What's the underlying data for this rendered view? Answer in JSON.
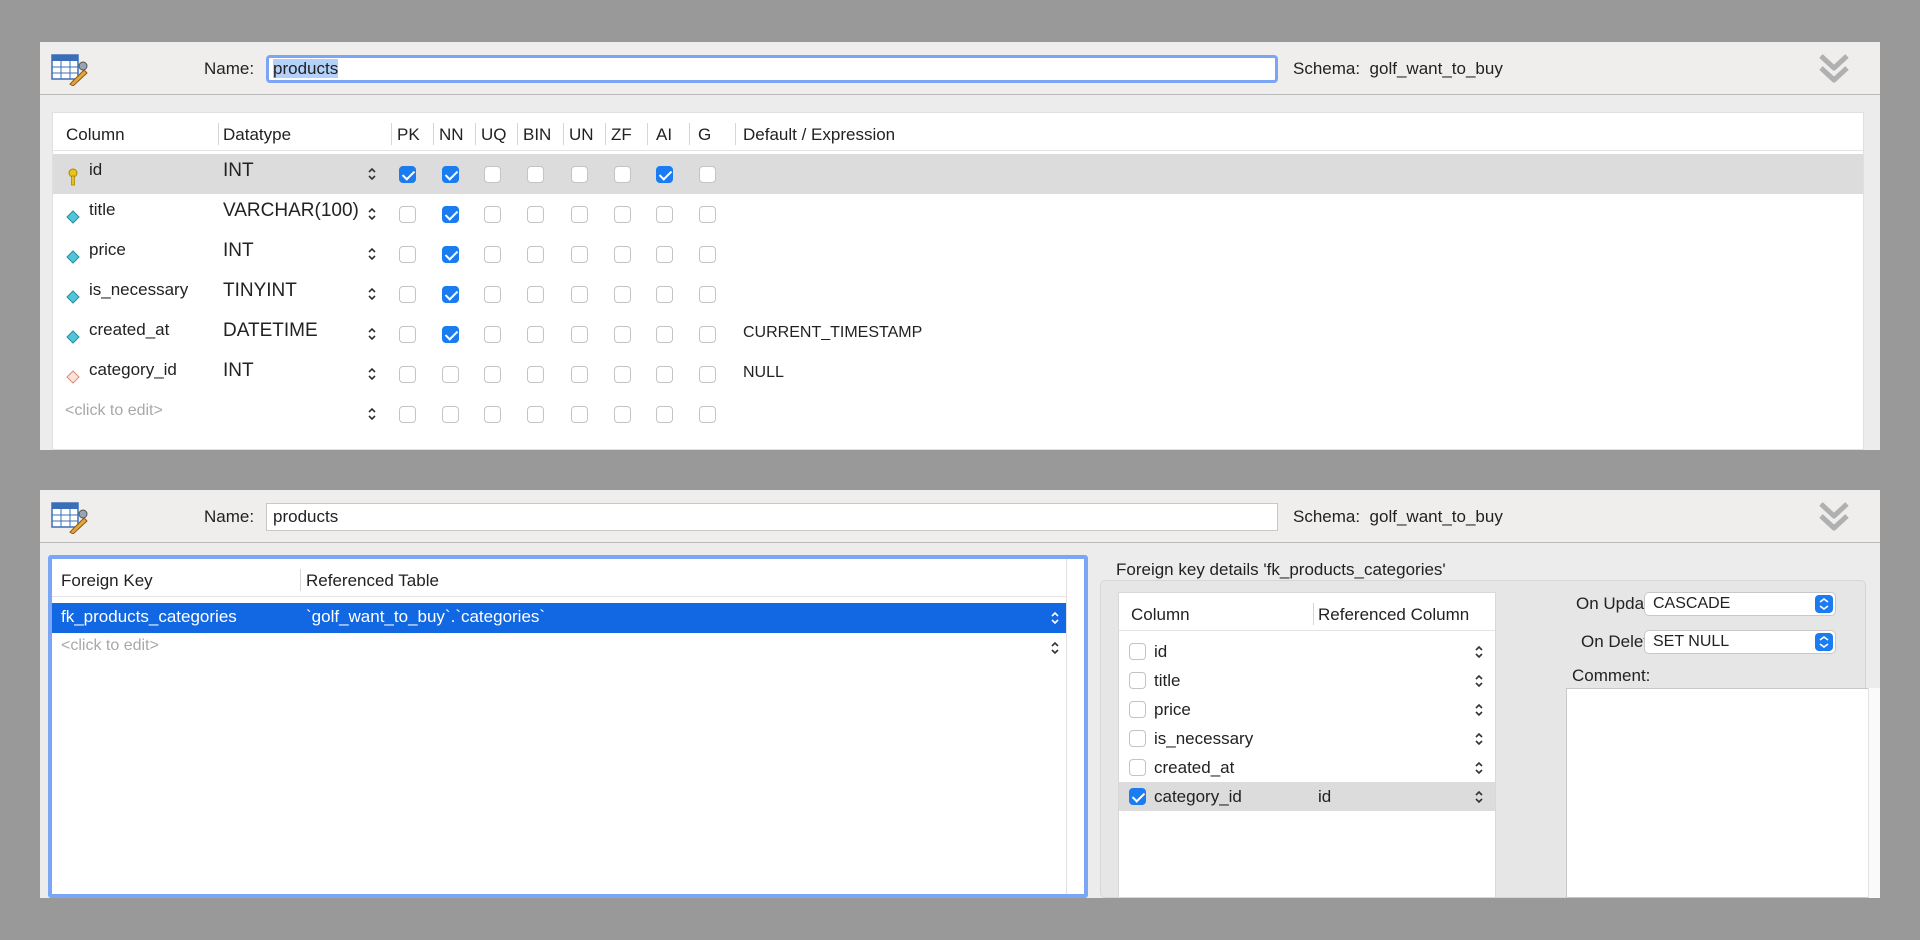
{
  "colors": {
    "background": "#999999",
    "selection_blue": "#1267e3",
    "checkbox_blue": "#1a7cf0",
    "focus_ring": "#7aa6f5",
    "pk_key_icon": "#e8c21e",
    "column_icon": "#4fc7d8",
    "fk_column_icon": "#e8a08a"
  },
  "top_panel": {
    "name_label": "Name:",
    "name_value": "products",
    "schema_label": "Schema:",
    "schema_value": "golf_want_to_buy",
    "headers": {
      "column": "Column",
      "datatype": "Datatype",
      "pk": "PK",
      "nn": "NN",
      "uq": "UQ",
      "bin": "BIN",
      "un": "UN",
      "zf": "ZF",
      "ai": "AI",
      "g": "G",
      "default": "Default / Expression"
    },
    "rows": [
      {
        "icon": "primary-key-icon",
        "name": "id",
        "type": "INT",
        "pk": true,
        "nn": true,
        "uq": false,
        "bin": false,
        "un": false,
        "zf": false,
        "ai": true,
        "g": false,
        "default": ""
      },
      {
        "icon": "column-icon",
        "name": "title",
        "type": "VARCHAR(100)",
        "pk": false,
        "nn": true,
        "uq": false,
        "bin": false,
        "un": false,
        "zf": false,
        "ai": false,
        "g": false,
        "default": ""
      },
      {
        "icon": "column-icon",
        "name": "price",
        "type": "INT",
        "pk": false,
        "nn": true,
        "uq": false,
        "bin": false,
        "un": false,
        "zf": false,
        "ai": false,
        "g": false,
        "default": ""
      },
      {
        "icon": "column-icon",
        "name": "is_necessary",
        "type": "TINYINT",
        "pk": false,
        "nn": true,
        "uq": false,
        "bin": false,
        "un": false,
        "zf": false,
        "ai": false,
        "g": false,
        "default": ""
      },
      {
        "icon": "column-icon",
        "name": "created_at",
        "type": "DATETIME",
        "pk": false,
        "nn": true,
        "uq": false,
        "bin": false,
        "un": false,
        "zf": false,
        "ai": false,
        "g": false,
        "default": "CURRENT_TIMESTAMP"
      },
      {
        "icon": "fk-column-icon",
        "name": "category_id",
        "type": "INT",
        "pk": false,
        "nn": false,
        "uq": false,
        "bin": false,
        "un": false,
        "zf": false,
        "ai": false,
        "g": false,
        "default": "NULL"
      }
    ],
    "placeholder_row": "<click to edit>"
  },
  "bottom_panel": {
    "name_label": "Name:",
    "name_value": "products",
    "schema_label": "Schema:",
    "schema_value": "golf_want_to_buy",
    "fk_headers": {
      "foreign_key": "Foreign Key",
      "referenced_table": "Referenced Table"
    },
    "fk_rows": [
      {
        "name": "fk_products_categories",
        "table": "`golf_want_to_buy`.`categories`"
      }
    ],
    "fk_placeholder": "<click to edit>",
    "details_title": "Foreign key details 'fk_products_categories'",
    "rc_headers": {
      "column": "Column",
      "referenced_column": "Referenced Column"
    },
    "rc_rows": [
      {
        "name": "id",
        "checked": false,
        "ref": ""
      },
      {
        "name": "title",
        "checked": false,
        "ref": ""
      },
      {
        "name": "price",
        "checked": false,
        "ref": ""
      },
      {
        "name": "is_necessary",
        "checked": false,
        "ref": ""
      },
      {
        "name": "created_at",
        "checked": false,
        "ref": ""
      },
      {
        "name": "category_id",
        "checked": true,
        "ref": "id"
      }
    ],
    "on_update_label": "On Update:",
    "on_update_value": "CASCADE",
    "on_delete_label": "On Delete:",
    "on_delete_value": "SET NULL",
    "comment_label": "Comment:",
    "comment_value": ""
  }
}
